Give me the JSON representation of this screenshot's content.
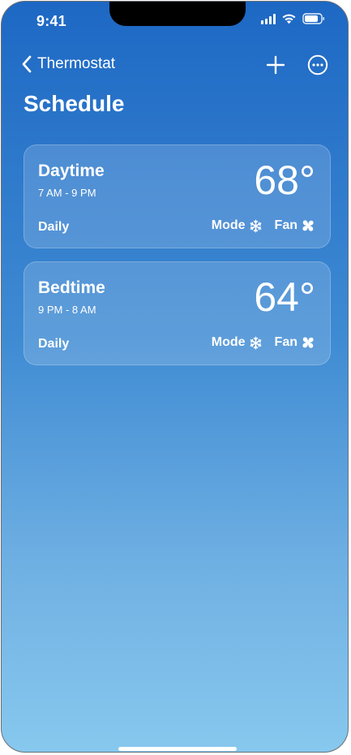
{
  "status": {
    "time": "9:41"
  },
  "nav": {
    "back_label": "Thermostat",
    "add_icon": "plus-icon",
    "more_icon": "ellipsis-circle-icon"
  },
  "page": {
    "title": "Schedule"
  },
  "schedules": [
    {
      "name": "Daytime",
      "time_range": "7 AM - 9 PM",
      "temperature": "68°",
      "frequency": "Daily",
      "mode_label": "Mode",
      "mode_icon": "snowflake-icon",
      "fan_label": "Fan",
      "fan_icon": "fan-icon"
    },
    {
      "name": "Bedtime",
      "time_range": "9 PM - 8 AM",
      "temperature": "64°",
      "frequency": "Daily",
      "mode_label": "Mode",
      "mode_icon": "snowflake-icon",
      "fan_label": "Fan",
      "fan_icon": "fan-icon"
    }
  ],
  "colors": {
    "gradient_top": "#1d68c4",
    "gradient_bottom": "#87c8ee",
    "text": "#ffffff"
  }
}
